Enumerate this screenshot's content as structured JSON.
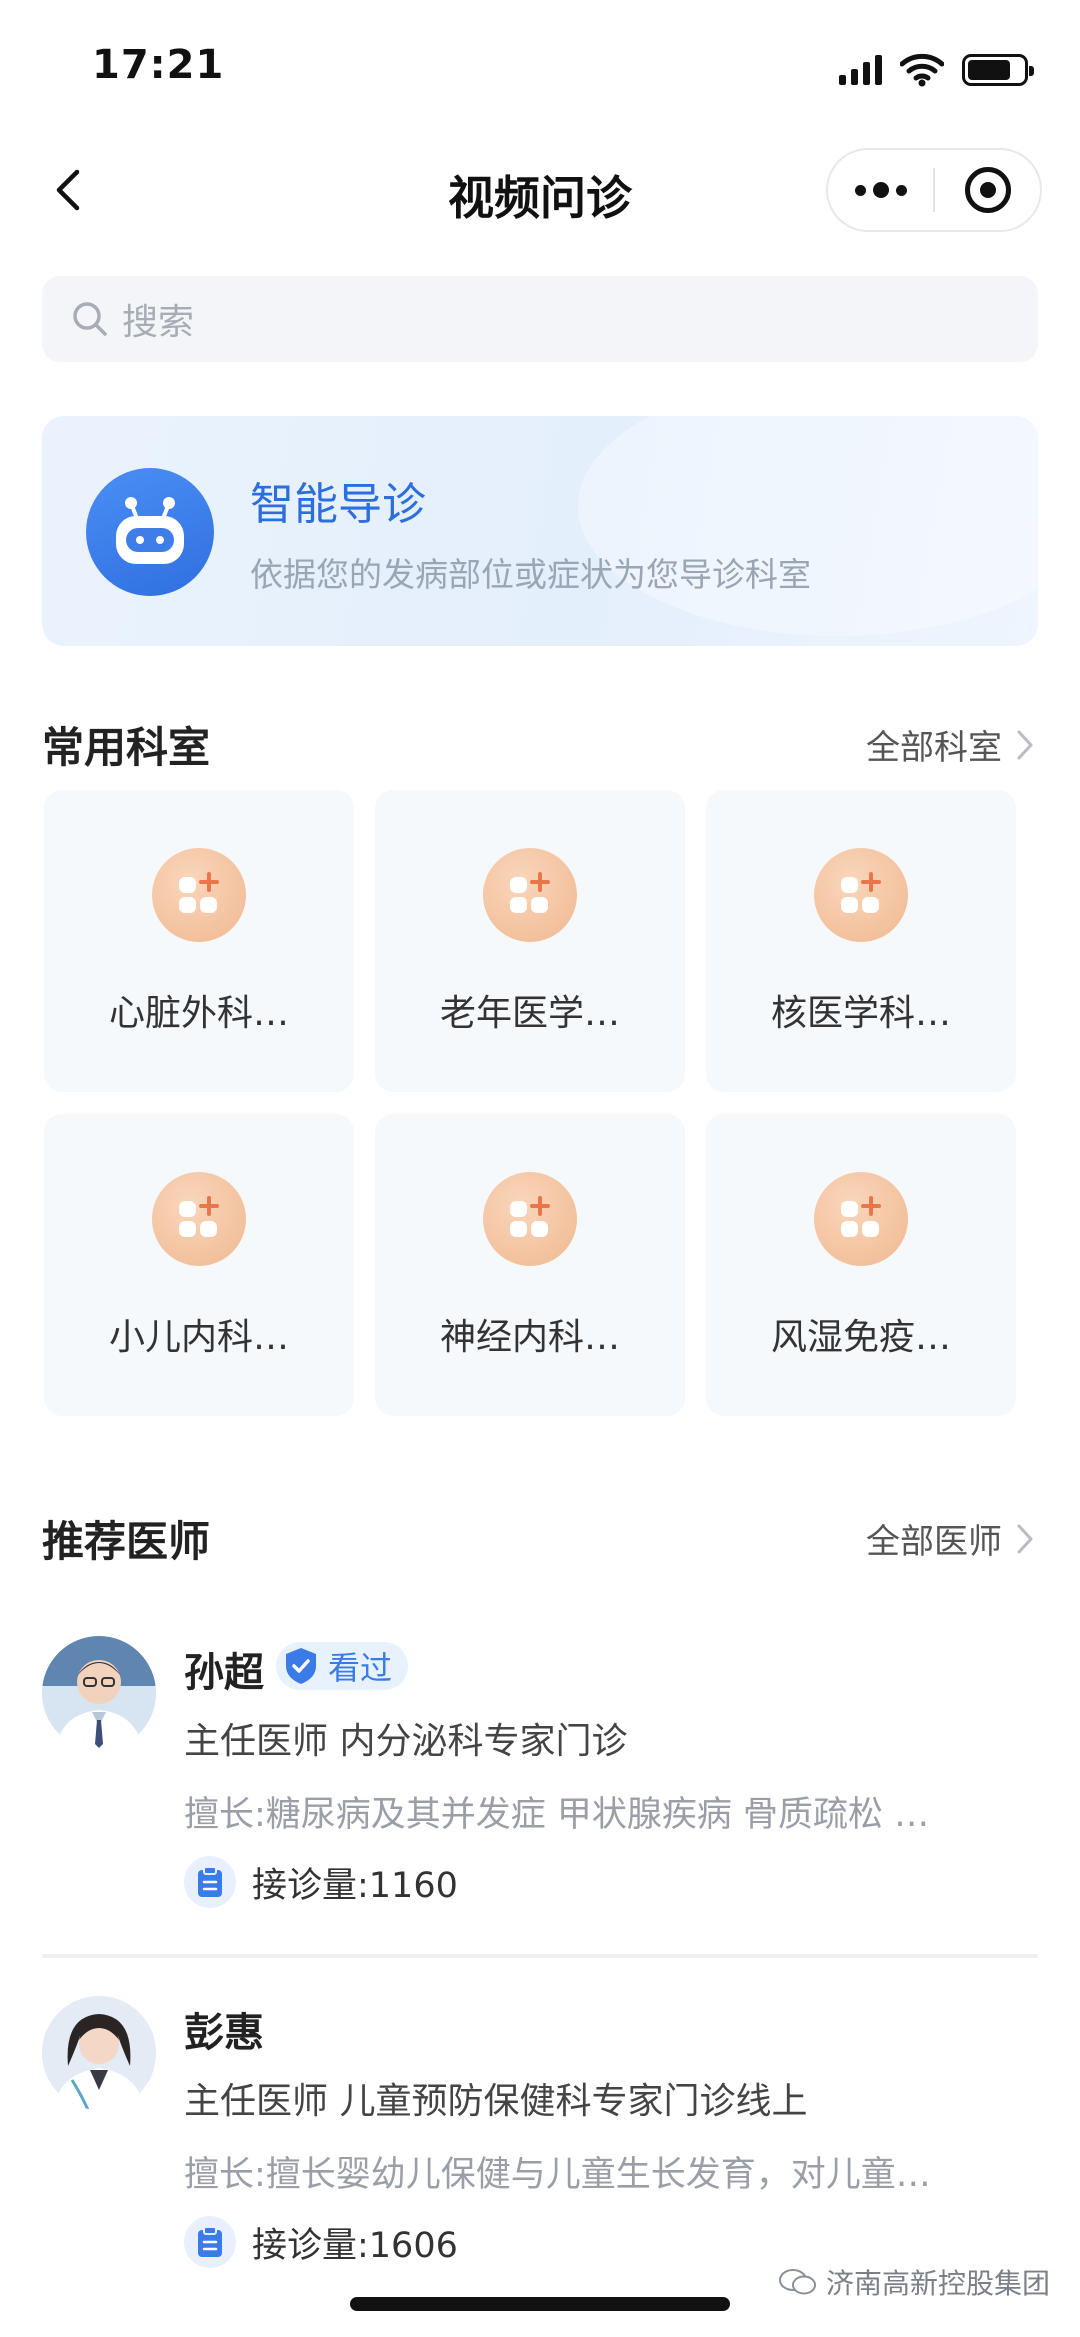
{
  "status_bar": {
    "time": "17:21"
  },
  "nav": {
    "title": "视频问诊"
  },
  "search": {
    "placeholder": "搜索"
  },
  "guide": {
    "title": "智能导诊",
    "subtitle": "依据您的发病部位或症状为您导诊科室"
  },
  "departments": {
    "title": "常用科室",
    "link": "全部科室",
    "items": [
      {
        "label": "心脏外科…"
      },
      {
        "label": "老年医学…"
      },
      {
        "label": "核医学科…"
      },
      {
        "label": "小儿内科…"
      },
      {
        "label": "神经内科…"
      },
      {
        "label": "风湿免疫…"
      }
    ]
  },
  "doctors": {
    "title": "推荐医师",
    "link": "全部医师",
    "items": [
      {
        "name": "孙超",
        "badge": "看过",
        "title": "主任医师  内分泌科专家门诊",
        "skill": "擅长:糖尿病及其并发症 甲状腺疾病 骨质疏松 …",
        "count": "接诊量:1160"
      },
      {
        "name": "彭惠",
        "title": "主任医师  儿童预防保健科专家门诊线上",
        "skill": "擅长:擅长婴幼儿保健与儿童生长发育，对儿童…",
        "count": "接诊量:1606"
      }
    ]
  },
  "watermark": "济南高新控股集团",
  "colors": {
    "accent": "#2c6de0",
    "dept_icon": "#f0b890",
    "background": "#ffffff"
  }
}
